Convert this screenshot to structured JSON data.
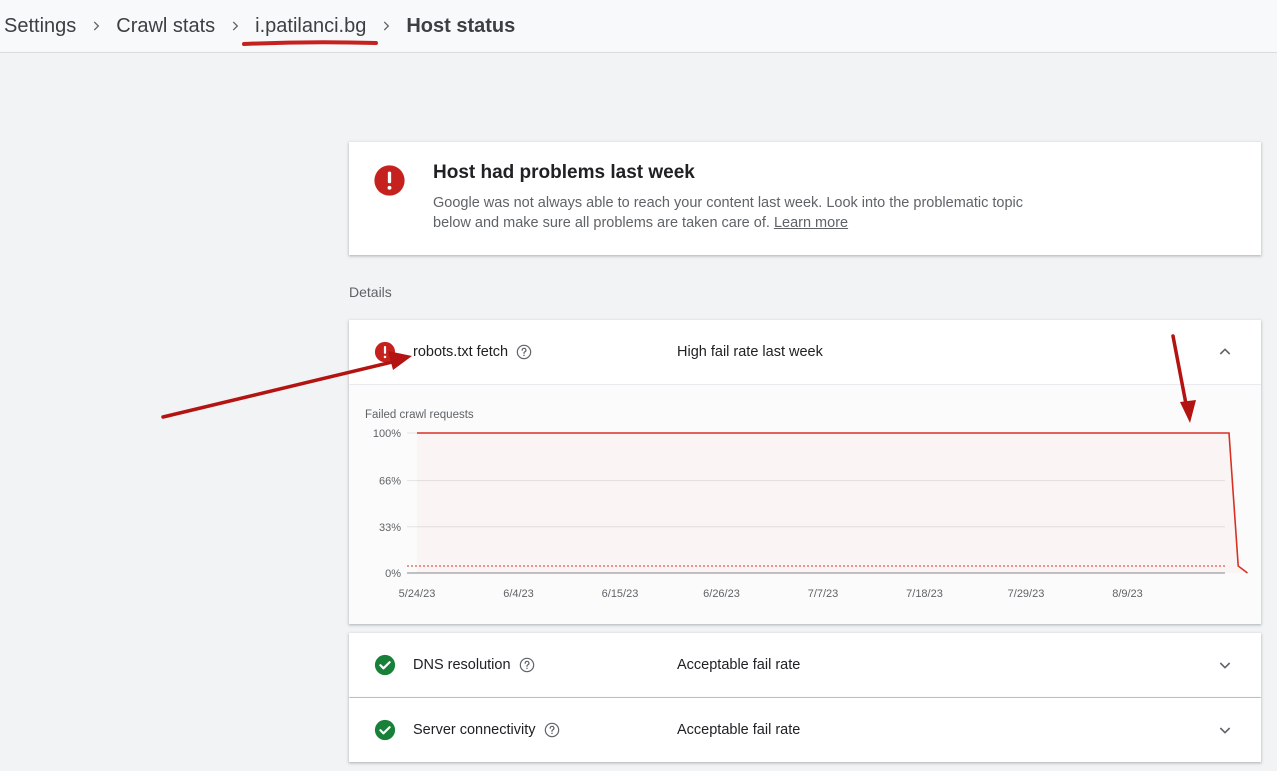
{
  "breadcrumb": {
    "items": [
      "Settings",
      "Crawl stats",
      "i.patilanci.bg"
    ],
    "current": "Host status"
  },
  "alert": {
    "title": "Host had problems last week",
    "body": "Google was not always able to reach your content last week. Look into the problematic topic below and make sure all problems are taken care of.",
    "link": "Learn more",
    "icon": "error-icon"
  },
  "details_label": "Details",
  "checks": [
    {
      "title": "robots.txt fetch",
      "status": "High fail rate last week",
      "state": "error",
      "expanded": true
    },
    {
      "title": "DNS resolution",
      "status": "Acceptable fail rate",
      "state": "ok",
      "expanded": false
    },
    {
      "title": "Server connectivity",
      "status": "Acceptable fail rate",
      "state": "ok",
      "expanded": false
    }
  ],
  "colors": {
    "error": "#c5221f",
    "ok": "#188038",
    "chart_line": "#d93025",
    "annotation": "#b31412"
  },
  "chart_data": {
    "type": "line",
    "title": "Failed crawl requests",
    "ylabel": "",
    "xlabel": "",
    "y_ticks": [
      "100%",
      "66%",
      "33%",
      "0%"
    ],
    "x_ticks": [
      "5/24/23",
      "6/4/23",
      "6/15/23",
      "6/26/23",
      "7/7/23",
      "7/18/23",
      "7/29/23",
      "8/9/23"
    ],
    "ylim": [
      0,
      100
    ],
    "series": [
      {
        "values": [
          {
            "x": "5/24/23",
            "y": 100
          },
          {
            "x": "8/20/23",
            "y": 100
          },
          {
            "x": "8/21/23",
            "y": 5
          },
          {
            "x": "8/22/23",
            "y": 0
          }
        ]
      }
    ],
    "threshold": 5,
    "grid": true
  }
}
